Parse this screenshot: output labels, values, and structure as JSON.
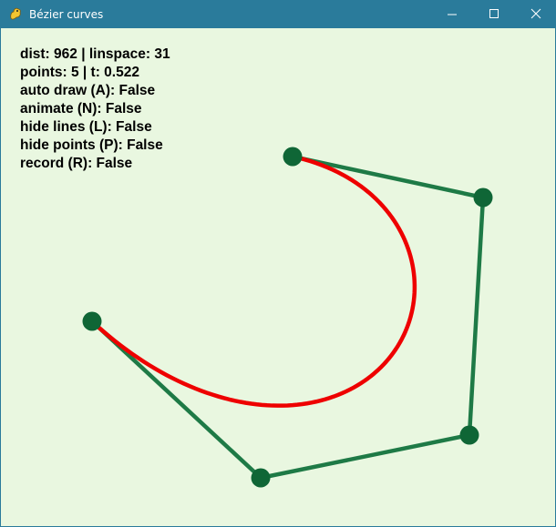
{
  "window": {
    "title": "Bézier curves",
    "controls": {
      "minimize_icon": "minimize-icon",
      "maximize_icon": "maximize-icon",
      "close_icon": "close-icon"
    },
    "app_icon": "pygame-snake-icon"
  },
  "hud": {
    "line1": "dist: 962 | linspace: 31",
    "line2": "points: 5 | t: 0.522",
    "line3": "auto draw (A): False",
    "line4": "animate (N): False",
    "line5": "hide lines (L): False",
    "line6": "hide points (P): False",
    "line7": "record (R): False"
  },
  "colors": {
    "titlebar": "#2a7b9b",
    "canvas_background": "#e9f7e0",
    "control_line": "#1e7a46",
    "control_point": "#0f6636",
    "curve": "#ee0000"
  },
  "control_points_count": 5
}
